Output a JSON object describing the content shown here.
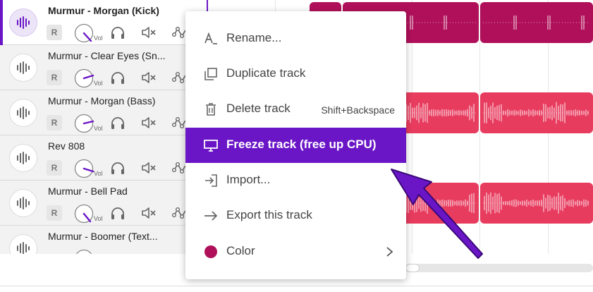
{
  "colors": {
    "accent": "#6a16c7",
    "clip_dark": "#b0105a",
    "clip_light": "#e83c5f",
    "color_swatch": "#b0105a"
  },
  "tracks": [
    {
      "name": "Murmur - Morgan (Kick)",
      "record": "R",
      "vol_label": "Vol",
      "selected": true
    },
    {
      "name": "Murmur - Clear Eyes (Sn...",
      "record": "R",
      "vol_label": "Vol",
      "selected": false
    },
    {
      "name": "Murmur - Morgan (Bass)",
      "record": "R",
      "vol_label": "Vol",
      "selected": false
    },
    {
      "name": "Rev 808",
      "record": "R",
      "vol_label": "Vol",
      "selected": false
    },
    {
      "name": "Murmur - Bell Pad",
      "record": "R",
      "vol_label": "Vol",
      "selected": false
    },
    {
      "name": "Murmur - Boomer (Text...",
      "record": "R",
      "vol_label": "Vol",
      "selected": false
    }
  ],
  "context_menu": {
    "items": [
      {
        "label": "Rename...",
        "icon": "rename-icon",
        "shortcut": ""
      },
      {
        "label": "Duplicate track",
        "icon": "duplicate-icon",
        "shortcut": ""
      },
      {
        "label": "Delete track",
        "icon": "trash-icon",
        "shortcut": "Shift+Backspace"
      },
      {
        "label": "Freeze track (free up CPU)",
        "icon": "monitor-icon",
        "shortcut": "",
        "highlighted": true
      },
      {
        "label": "Import...",
        "icon": "import-icon",
        "shortcut": ""
      },
      {
        "label": "Export this track",
        "icon": "arrow-right-icon",
        "shortcut": ""
      },
      {
        "label": "Color",
        "icon": "color-swatch-icon",
        "shortcut": "",
        "submenu": true
      }
    ]
  }
}
